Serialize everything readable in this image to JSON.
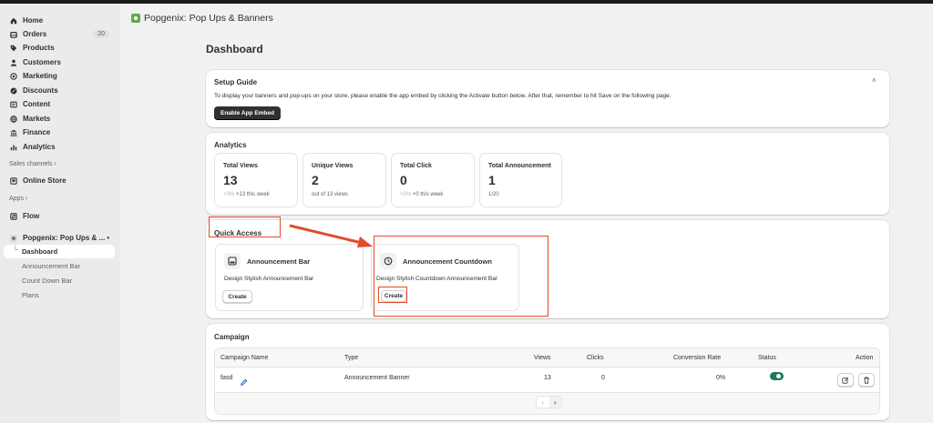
{
  "sidebar": {
    "nav": [
      {
        "label": "Home",
        "icon": "home-icon"
      },
      {
        "label": "Orders",
        "icon": "orders-icon",
        "badge": "20"
      },
      {
        "label": "Products",
        "icon": "tag-icon"
      },
      {
        "label": "Customers",
        "icon": "person-icon"
      },
      {
        "label": "Marketing",
        "icon": "target-icon"
      },
      {
        "label": "Discounts",
        "icon": "discount-icon"
      },
      {
        "label": "Content",
        "icon": "content-icon"
      },
      {
        "label": "Markets",
        "icon": "globe-icon"
      },
      {
        "label": "Finance",
        "icon": "bank-icon"
      },
      {
        "label": "Analytics",
        "icon": "bar-chart-icon"
      }
    ],
    "sales_channels_label": "Sales channels",
    "online_store": "Online Store",
    "apps_label": "Apps",
    "flow": "Flow",
    "app_name": "Popgenix: Pop Ups & ...",
    "app_dots": "•",
    "sub_items": [
      "Dashboard",
      "Announcement Bar",
      "Count Down Bar",
      "Plans"
    ]
  },
  "app_header": {
    "title": "Popgenix: Pop Ups & Banners"
  },
  "page_title": "Dashboard",
  "setup_guide": {
    "title": "Setup Guide",
    "text": "To display your banners and pop-ups on your store, please enable the app embed by clicking the Activate button below. After that, remember to hit Save on the following page.",
    "button": "Enable App Embed"
  },
  "analytics": {
    "title": "Analytics",
    "stats": [
      {
        "label": "Total Views",
        "value": "13",
        "change": "+0%",
        "sub": "+13 this week"
      },
      {
        "label": "Unique Views",
        "value": "2",
        "change": "",
        "sub": "out of 13 views"
      },
      {
        "label": "Total Click",
        "value": "0",
        "change": "+0%",
        "sub": "+0 this week"
      },
      {
        "label": "Total Announcement",
        "value": "1",
        "change": "",
        "sub": "1/20"
      }
    ]
  },
  "quick_access": {
    "title": "Quick Access",
    "items": [
      {
        "title": "Announcement Bar",
        "desc": "Design Stylish Announcement Bar",
        "button": "Create"
      },
      {
        "title": "Announcement Countdown",
        "desc": "Design Stylish Countdown Announcement Bar",
        "button": "Create"
      }
    ]
  },
  "campaign": {
    "title": "Campaign",
    "columns": [
      "Campaign Name",
      "Type",
      "Views",
      "Clicks",
      "Conversion Rate",
      "Status",
      "Action"
    ],
    "rows": [
      {
        "name": "fasd",
        "type": "Announcement Banner",
        "views": "13",
        "clicks": "0",
        "conversion": "0%",
        "status": "on"
      }
    ]
  },
  "colors": {
    "highlight": "#e24b2c",
    "toggle_on": "#1f7a5c",
    "accent_logo": "#63a94b"
  }
}
